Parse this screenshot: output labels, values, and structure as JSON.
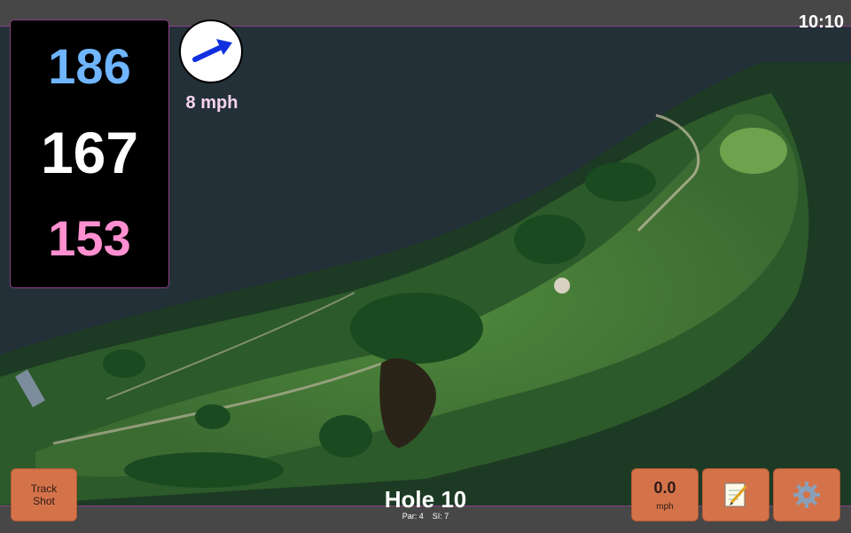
{
  "status": {
    "time": "10:10"
  },
  "distances": {
    "back": "186",
    "middle": "167",
    "front": "153"
  },
  "wind": {
    "speed_text": "8 mph",
    "icon": "wind-arrow-icon"
  },
  "buttons": {
    "track_shot_line1": "Track",
    "track_shot_line2": "Shot",
    "speed_value": "0.0",
    "speed_unit": "mph",
    "notes_icon": "notepad-icon",
    "settings_icon": "gear-icon"
  },
  "hole": {
    "title": "Hole 10",
    "par_label": "Par: 4",
    "si_label": "SI: 7"
  },
  "colors": {
    "back_distance": "#6fb5ff",
    "middle_distance": "#ffffff",
    "front_distance": "#ff8fd0",
    "button": "#d4734a",
    "accent_border": "#8b3f86"
  }
}
